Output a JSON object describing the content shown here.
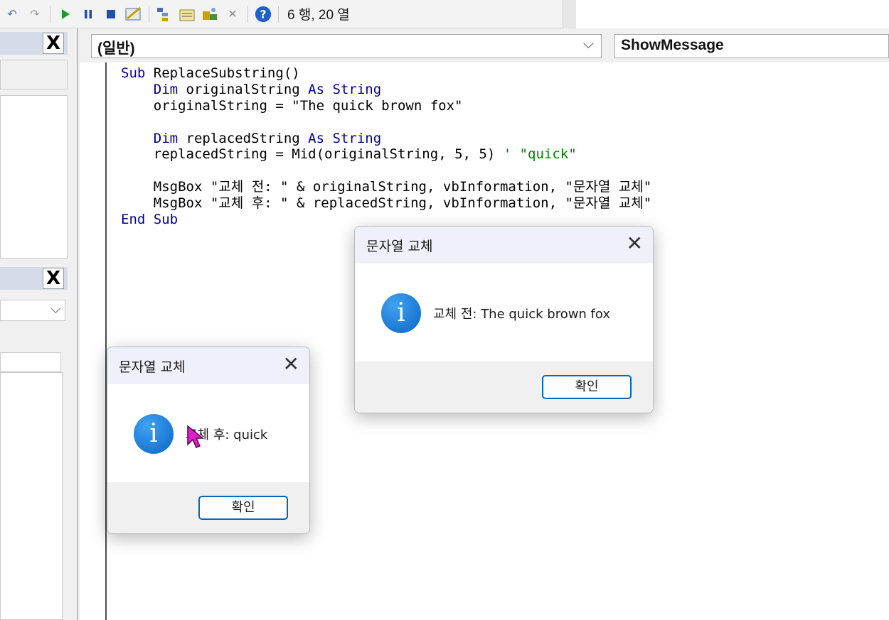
{
  "toolbar": {
    "status": "6 행, 20 열",
    "icons": [
      "undo-icon",
      "redo-icon",
      "run-icon",
      "pause-icon",
      "stop-icon",
      "design-mode-icon",
      "project-explorer-icon",
      "properties-icon",
      "object-browser-icon",
      "toolbox-icon",
      "help-icon"
    ]
  },
  "editor": {
    "object_combo": "(일반)",
    "procedure_combo": "ShowMessage",
    "code_lines": [
      "Sub ReplaceSubstring()",
      "    Dim originalString As String",
      "    originalString = \"The quick brown fox\"",
      "",
      "    Dim replacedString As String",
      "    replacedString = Mid(originalString, 5, 5) ' \"quick\"",
      "",
      "    MsgBox \"교체 전: \" & originalString, vbInformation, \"문자열 교체\"",
      "    MsgBox \"교체 후: \" & replacedString, vbInformation, \"문자열 교체\"",
      "End Sub"
    ]
  },
  "dialogs": [
    {
      "title": "문자열 교체",
      "message": "교체 전: The quick brown fox",
      "ok_label": "확인",
      "icon": "information-icon"
    },
    {
      "title": "문자열 교체",
      "message": "교체 후: quick",
      "ok_label": "확인",
      "icon": "information-icon"
    }
  ],
  "left_panel": {
    "close_label": "X"
  },
  "colors": {
    "keyword": "#00008b",
    "comment": "#008000",
    "accent": "#0067c0"
  }
}
